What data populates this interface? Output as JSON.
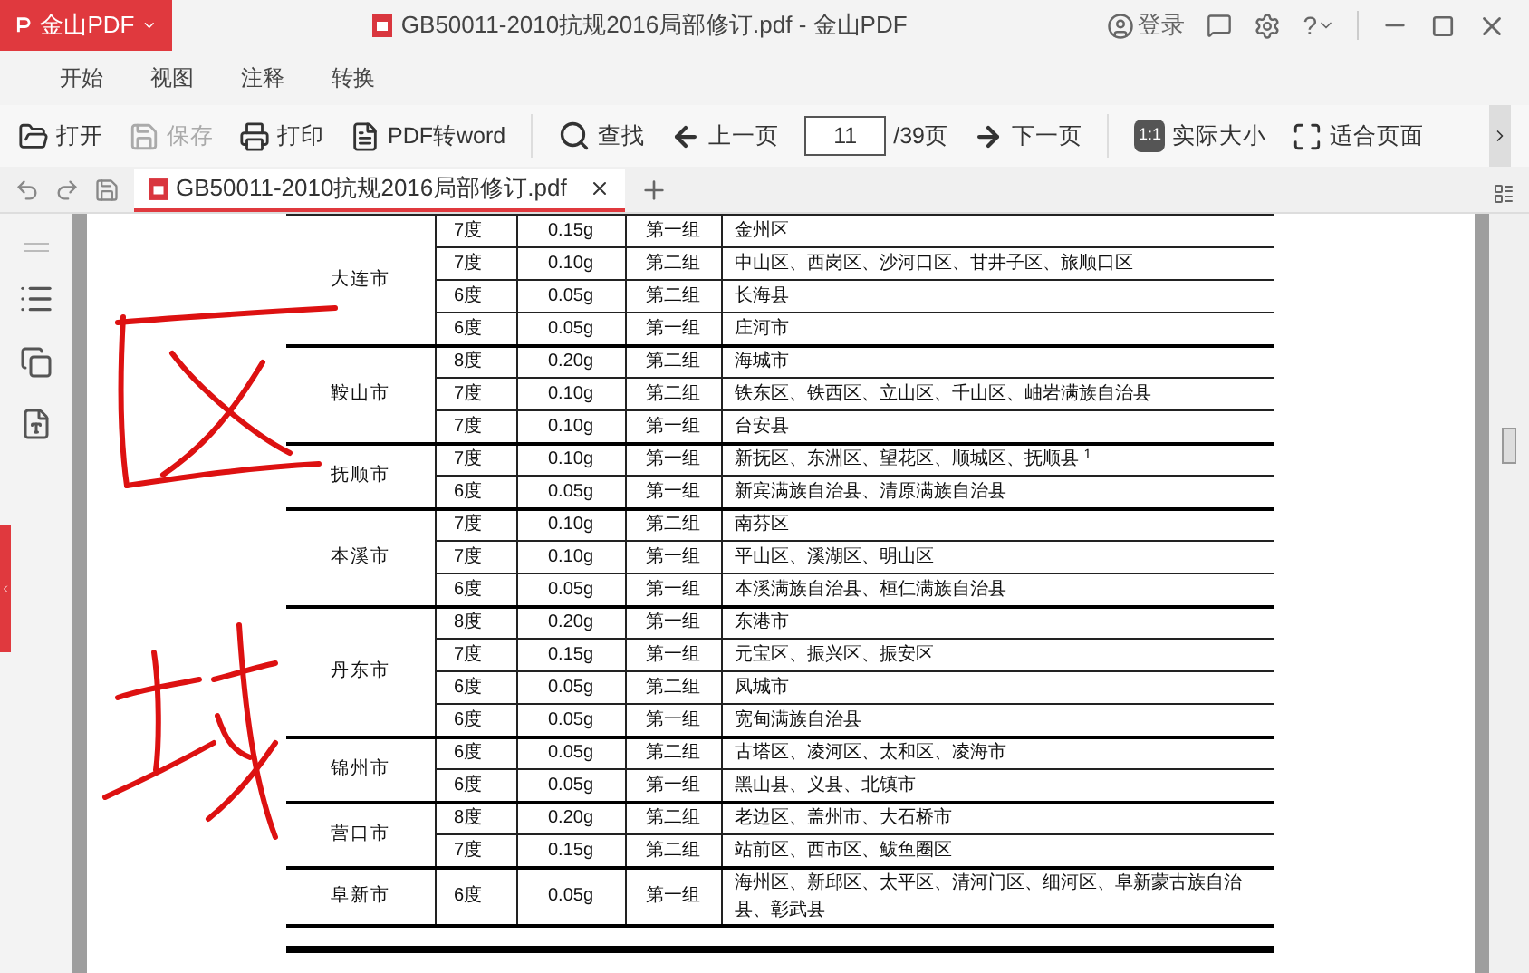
{
  "app": {
    "name": "金山PDF"
  },
  "window": {
    "title": "GB50011-2010抗规2016局部修订.pdf - 金山PDF",
    "login": "登录",
    "help": "?"
  },
  "menu_tabs": [
    {
      "label": "开始"
    },
    {
      "label": "视图"
    },
    {
      "label": "注释"
    },
    {
      "label": "转换"
    }
  ],
  "toolbar": {
    "file_buttons": [
      {
        "label": "打开",
        "disabled": false
      },
      {
        "label": "保存",
        "disabled": true
      },
      {
        "label": "打印",
        "disabled": false
      },
      {
        "label": "PDF转word",
        "disabled": false
      }
    ],
    "find": "查找",
    "prev": "上一页",
    "page_input": {
      "value": "11"
    },
    "page_total": "/39页",
    "next": "下一页",
    "actual_size": {
      "badge": "1:1",
      "label": "实际大小"
    },
    "fit_page": "适合页面"
  },
  "doc_tabs": [
    {
      "title": "GB50011-2010抗规2016局部修订.pdf",
      "selected": true
    }
  ],
  "table": {
    "groups": [
      {
        "city": "大连市",
        "rows": [
          [
            "7度",
            "0.15g",
            "第一组",
            "金州区"
          ],
          [
            "7度",
            "0.10g",
            "第二组",
            "中山区、西岗区、沙河口区、甘井子区、旅顺口区"
          ],
          [
            "6度",
            "0.05g",
            "第二组",
            "长海县"
          ],
          [
            "6度",
            "0.05g",
            "第一组",
            "庄河市"
          ]
        ]
      },
      {
        "city": "鞍山市",
        "rows": [
          [
            "8度",
            "0.20g",
            "第二组",
            "海城市"
          ],
          [
            "7度",
            "0.10g",
            "第二组",
            "铁东区、铁西区、立山区、千山区、岫岩满族自治县"
          ],
          [
            "7度",
            "0.10g",
            "第一组",
            "台安县"
          ]
        ]
      },
      {
        "city": "抚顺市",
        "rows": [
          [
            "7度",
            "0.10g",
            "第一组",
            "新抚区、东洲区、望花区、顺城区、抚顺县 $^{1}$"
          ],
          [
            "6度",
            "0.05g",
            "第一组",
            "新宾满族自治县、清原满族自治县"
          ]
        ]
      },
      {
        "city": "本溪市",
        "rows": [
          [
            "7度",
            "0.10g",
            "第二组",
            "南芬区"
          ],
          [
            "7度",
            "0.10g",
            "第一组",
            "平山区、溪湖区、明山区"
          ],
          [
            "6度",
            "0.05g",
            "第一组",
            "本溪满族自治县、桓仁满族自治县"
          ]
        ]
      },
      {
        "city": "丹东市",
        "rows": [
          [
            "8度",
            "0.20g",
            "第一组",
            "东港市"
          ],
          [
            "7度",
            "0.15g",
            "第一组",
            "元宝区、振兴区、振安区"
          ],
          [
            "6度",
            "0.05g",
            "第二组",
            "凤城市"
          ],
          [
            "6度",
            "0.05g",
            "第一组",
            "宽甸满族自治县"
          ]
        ]
      },
      {
        "city": "锦州市",
        "rows": [
          [
            "6度",
            "0.05g",
            "第二组",
            "古塔区、凌河区、太和区、凌海市"
          ],
          [
            "6度",
            "0.05g",
            "第一组",
            "黑山县、义县、北镇市"
          ]
        ]
      },
      {
        "city": "营口市",
        "rows": [
          [
            "8度",
            "0.20g",
            "第二组",
            "老边区、盖州市、大石桥市"
          ],
          [
            "7度",
            "0.15g",
            "第二组",
            "站前区、西市区、鲅鱼圈区"
          ]
        ]
      },
      {
        "city": "阜新市",
        "rows": [
          [
            "6度",
            "0.05g",
            "第一组",
            "海州区、新邱区、太平区、清河门区、细河区、阜新蒙古族自治县、彰武县"
          ]
        ]
      }
    ]
  }
}
